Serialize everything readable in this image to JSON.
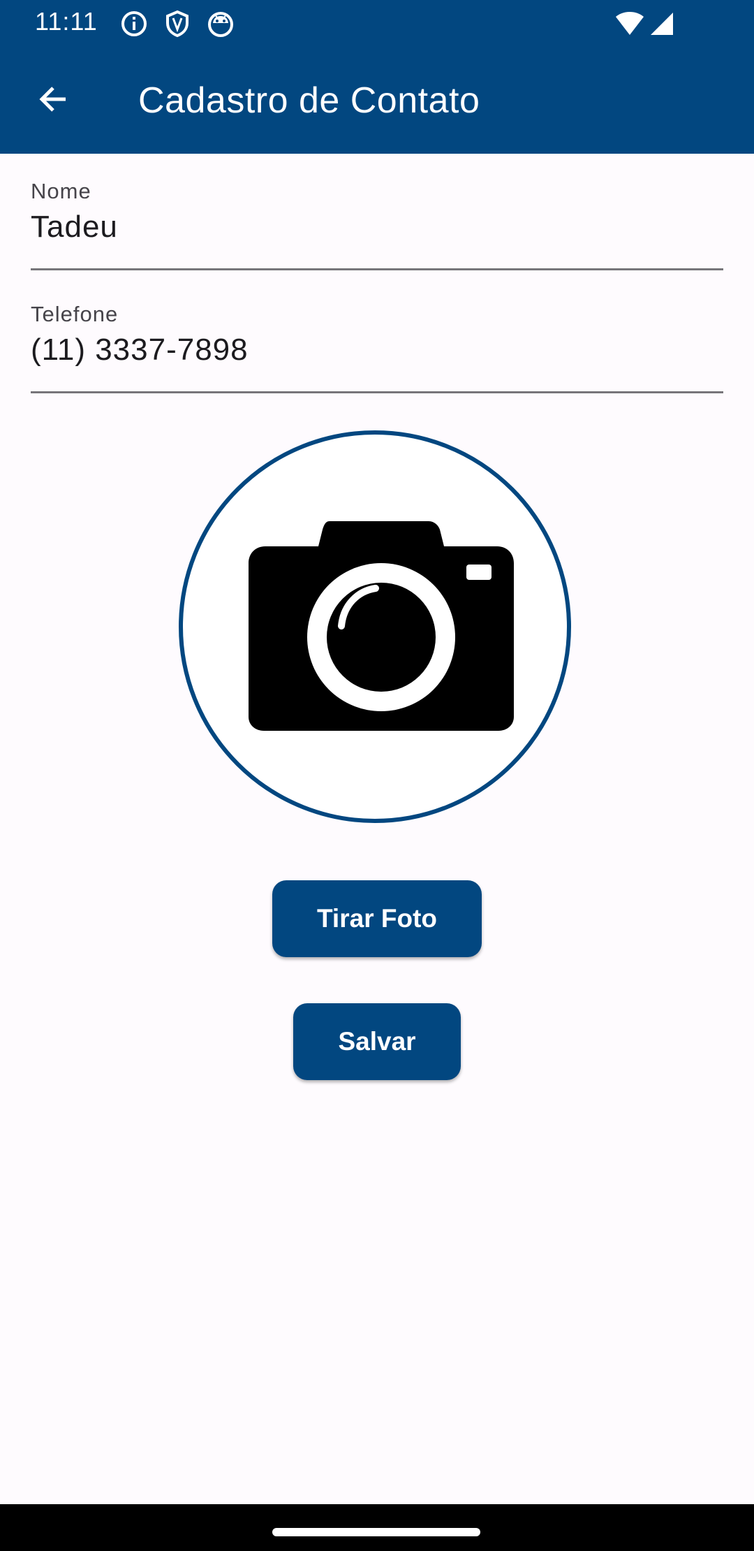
{
  "status_bar": {
    "time": "11:11",
    "left_icons": [
      "info-icon",
      "shield-icon",
      "android-icon"
    ],
    "right_icons": [
      "wifi-icon",
      "signal-icon"
    ]
  },
  "app_bar": {
    "back_icon": "arrow-back-icon",
    "title": "Cadastro de Contato"
  },
  "form": {
    "name": {
      "label": "Nome",
      "value": "Tadeu"
    },
    "phone": {
      "label": "Telefone",
      "value": "(11) 3337-7898"
    }
  },
  "photo": {
    "icon": "camera-icon"
  },
  "buttons": {
    "take_photo": "Tirar Foto",
    "save": "Salvar"
  },
  "colors": {
    "primary": "#024780",
    "background": "#fefbfe",
    "text": "#1c1b1f",
    "label": "#46444a",
    "underline": "#77757a"
  }
}
